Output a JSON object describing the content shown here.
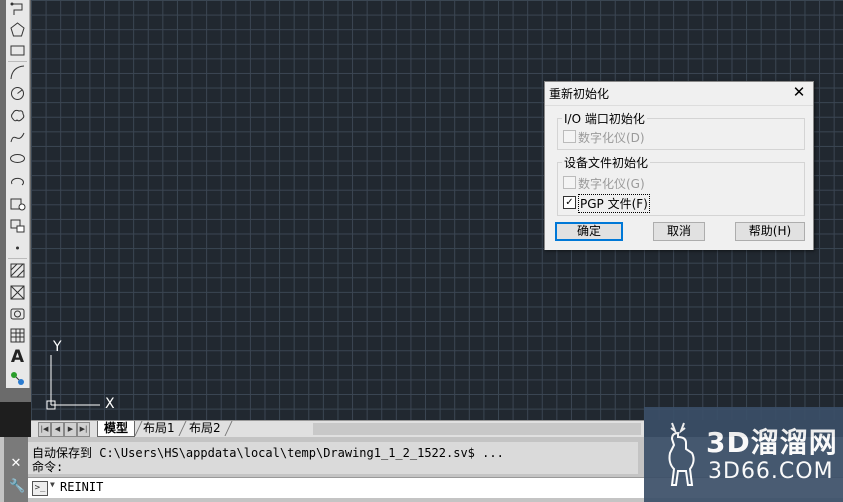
{
  "toolbar": {
    "icons": [
      "polyline-icon",
      "polygon-icon",
      "rectangle-icon",
      "arc-icon",
      "circle-icon",
      "revision-cloud-icon",
      "spline-icon",
      "ellipse-icon",
      "ellipse-arc-icon",
      "insert-block-icon",
      "make-block-icon",
      "point-icon",
      "hatch-icon",
      "gradient-icon",
      "region-icon",
      "table-icon",
      "multiline-text-icon",
      "add-selected-icon"
    ]
  },
  "ucs": {
    "y_label": "Y",
    "x_label": "X"
  },
  "tabs": {
    "items": [
      {
        "label": "模型",
        "active": true
      },
      {
        "label": "布局1",
        "active": false
      },
      {
        "label": "布局2",
        "active": false
      }
    ]
  },
  "command": {
    "history": [
      "自动保存到 C:\\Users\\HS\\appdata\\local\\temp\\Drawing1_1_2_1522.sv$ ...",
      "命令:"
    ],
    "input_value": "REINIT"
  },
  "dialog": {
    "title": "重新初始化",
    "group1": {
      "label": "I/O 端口初始化",
      "checkbox": {
        "label": "数字化仪(D)",
        "checked": false,
        "enabled": false
      }
    },
    "group2": {
      "label": "设备文件初始化",
      "checkboxes": [
        {
          "label": "数字化仪(G)",
          "checked": false,
          "enabled": false
        },
        {
          "label": "PGP 文件(F)",
          "checked": true,
          "enabled": true
        }
      ]
    },
    "buttons": {
      "ok": "确定",
      "cancel": "取消",
      "help": "帮助(H)"
    },
    "check_mark": "✓"
  },
  "watermark": {
    "line1": "3D溜溜网",
    "line2": "3D66.COM"
  }
}
